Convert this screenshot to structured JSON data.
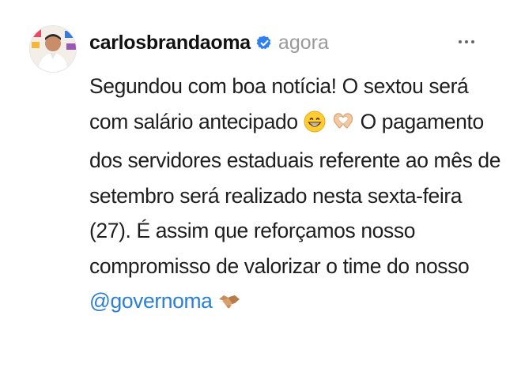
{
  "post": {
    "username": "carlosbrandaoma",
    "timestamp": "agora",
    "text_lines": [
      "Segundou com boa notícia! O sextou será",
      "com salário antecipado",
      "O pagamento",
      "dos servidores estaduais referente ao mês de",
      "setembro será realizado nesta sexta-feira",
      "(27). É assim que reforçamos nosso",
      "compromisso de valorizar o time do nosso"
    ],
    "mention": "@governoma",
    "icons": [
      "verified-badge-icon",
      "grinning-face-icon",
      "heart-hands-icon",
      "handshake-icon",
      "more-options-icon"
    ],
    "colors": {
      "verified": "#2f80ed",
      "mention": "#2b7fd4",
      "timestamp": "#9a9a9a"
    }
  }
}
